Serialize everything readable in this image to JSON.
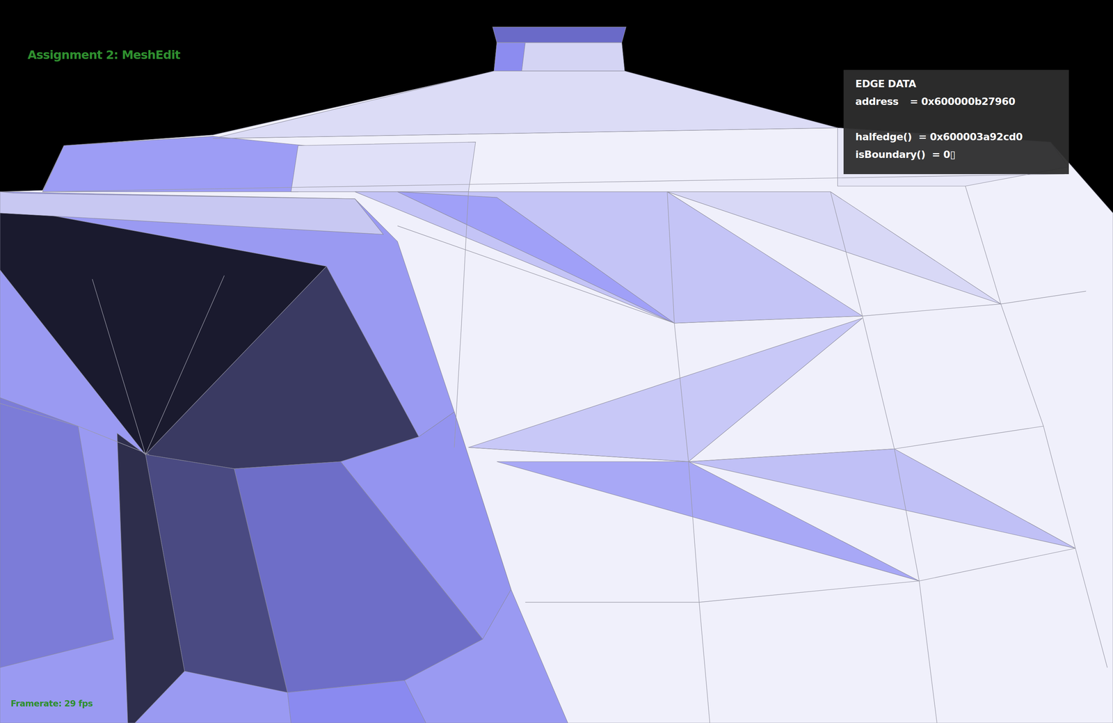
{
  "window": {
    "title": "Assignment 2: MeshEdit"
  },
  "viewport": {
    "description": "3D teapot mesh render"
  },
  "info_panel": {
    "heading": "EDGE DATA",
    "groups": [
      [
        {
          "label": "address",
          "value": "= 0x600000b27960"
        }
      ],
      [
        {
          "label": "halfedge()",
          "value": "= 0x600003a92cd0"
        },
        {
          "label": "isBoundary()",
          "value": "= 0▯"
        }
      ]
    ]
  },
  "status": {
    "framerate": "Framerate: 29 fps"
  }
}
